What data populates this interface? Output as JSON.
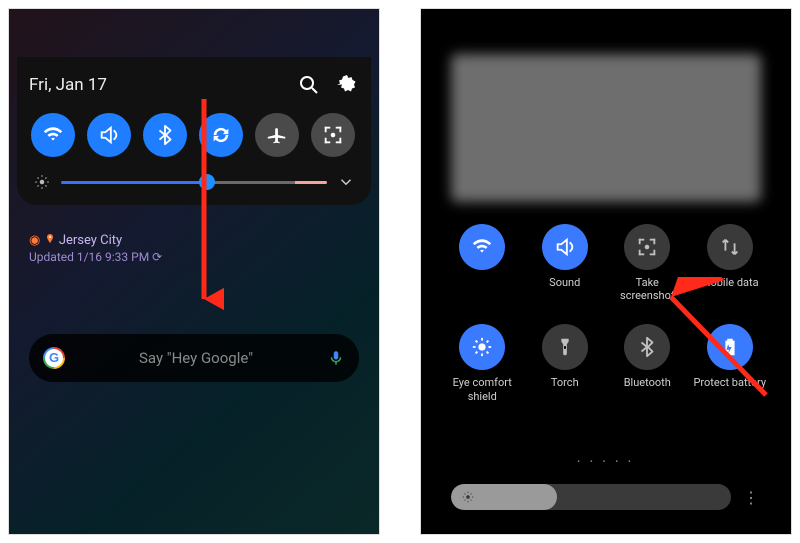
{
  "left": {
    "date": "Fri, Jan 17",
    "toggles": [
      {
        "name": "wifi",
        "on": true
      },
      {
        "name": "sound",
        "on": true
      },
      {
        "name": "bluetooth",
        "on": true
      },
      {
        "name": "sync",
        "on": true
      },
      {
        "name": "airplane",
        "on": false
      },
      {
        "name": "screenshot",
        "on": false
      }
    ],
    "brightness_percent": 55,
    "location": {
      "city": "Jersey City",
      "updated": "Updated 1/16 9:33 PM"
    },
    "google_placeholder": "Say \"Hey Google\""
  },
  "right": {
    "tiles": [
      {
        "name": "wifi",
        "label": "",
        "on": true,
        "shows_label": false
      },
      {
        "name": "sound",
        "label": "Sound",
        "on": true,
        "shows_label": true
      },
      {
        "name": "take-screenshot",
        "label": "Take screenshot",
        "on": false,
        "shows_label": true
      },
      {
        "name": "mobile-data",
        "label": "Mobile data",
        "on": false,
        "shows_label": true
      },
      {
        "name": "eye-comfort",
        "label": "Eye comfort shield",
        "on": true,
        "shows_label": true
      },
      {
        "name": "torch",
        "label": "Torch",
        "on": false,
        "shows_label": true
      },
      {
        "name": "bluetooth",
        "label": "Bluetooth",
        "on": false,
        "shows_label": true
      },
      {
        "name": "protect-battery",
        "label": "Protect battery",
        "on": true,
        "shows_label": true
      }
    ],
    "brightness_percent": 38,
    "page_dots": "•   • • • •"
  }
}
